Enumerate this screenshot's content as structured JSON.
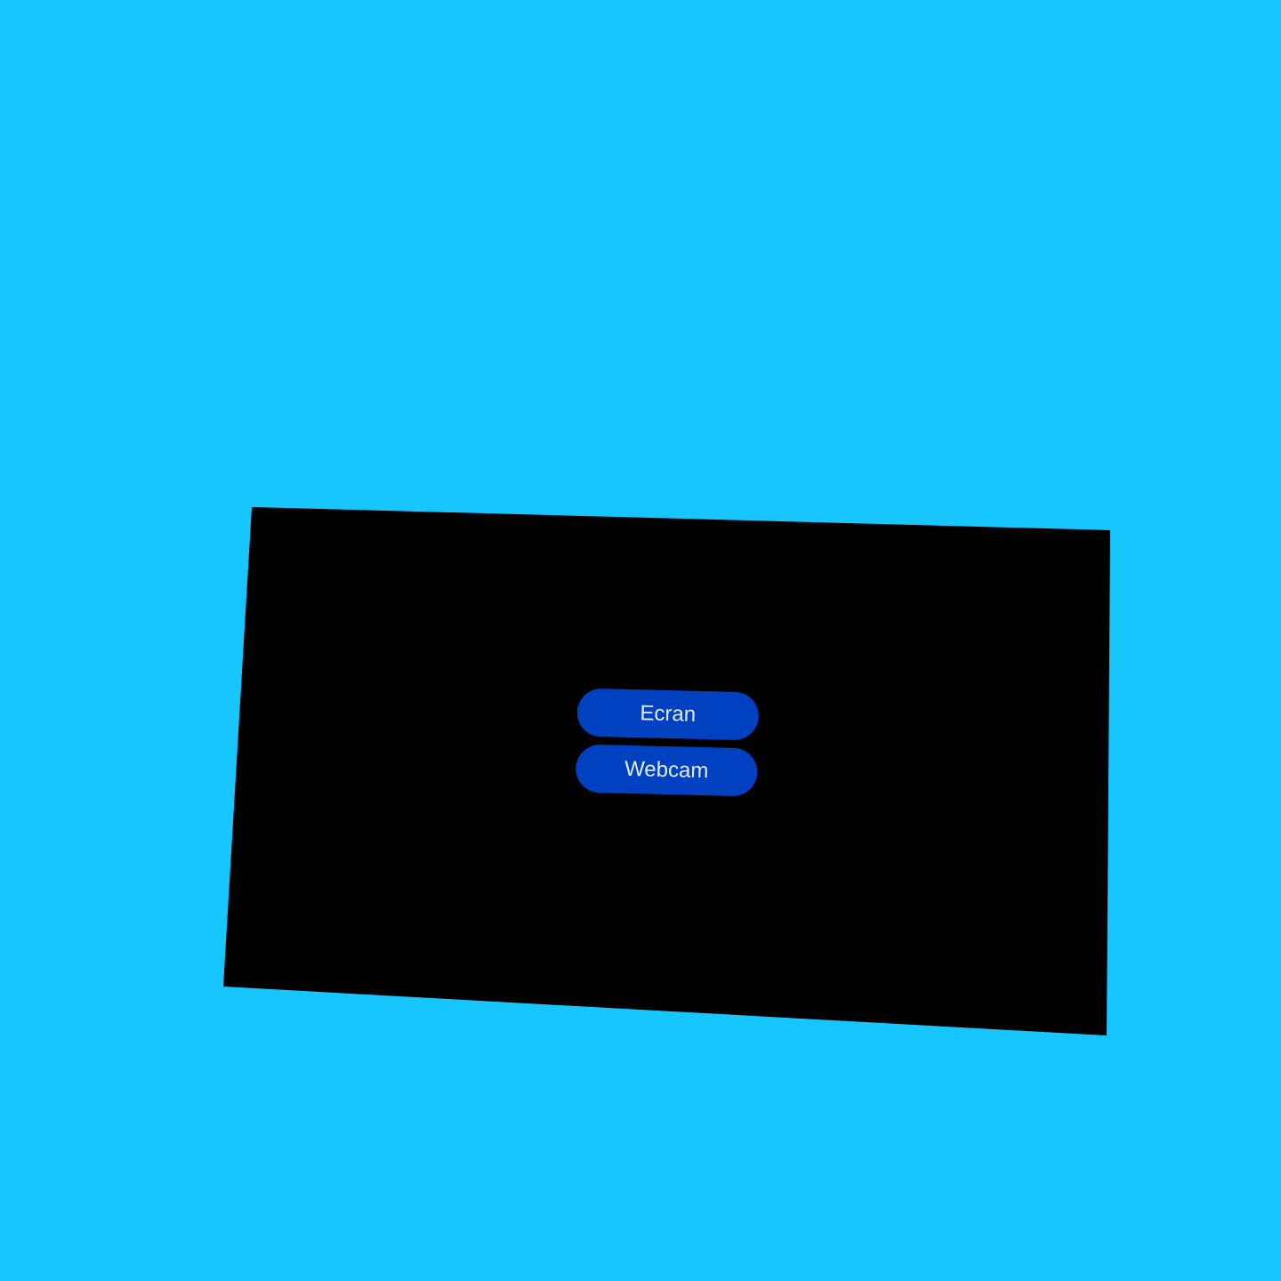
{
  "colors": {
    "background": "#17c6ff",
    "panel": "#000000",
    "button": "#0041c2",
    "button_text": "#e6ecff"
  },
  "source_picker": {
    "options": [
      {
        "label": "Ecran"
      },
      {
        "label": "Webcam"
      }
    ]
  }
}
